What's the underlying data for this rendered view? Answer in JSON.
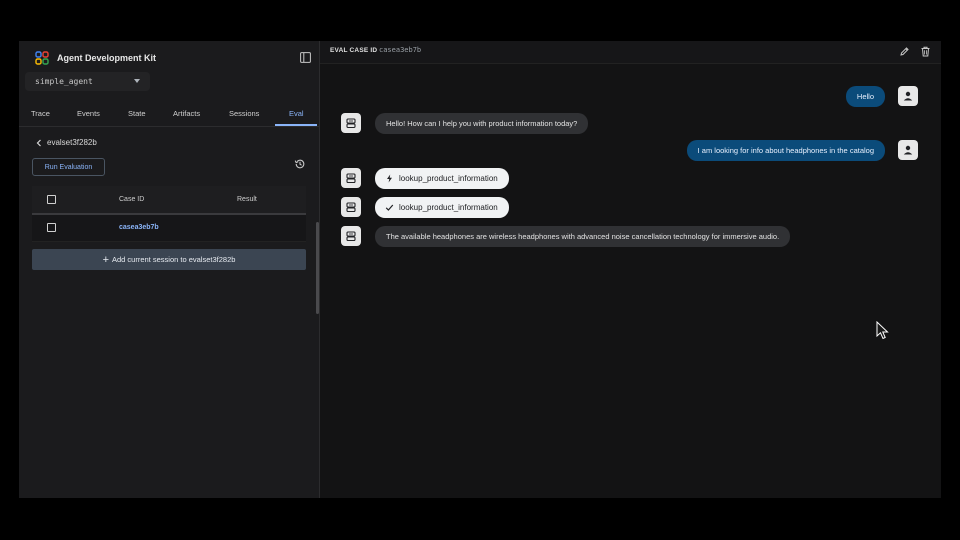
{
  "sidebar": {
    "brand_title": "Agent Development Kit",
    "agent_select_value": "simple_agent",
    "tabs": [
      "Trace",
      "Events",
      "State",
      "Artifacts",
      "Sessions",
      "Eval"
    ],
    "active_tab": "Eval",
    "breadcrumb": "evalset3f282b",
    "run_evaluation_label": "Run Evaluation",
    "table": {
      "columns": [
        "Case ID",
        "Result"
      ],
      "rows": [
        {
          "case_id": "casea3eb7b",
          "result": ""
        }
      ]
    },
    "add_session_label": "Add current session to evalset3f282b"
  },
  "main": {
    "header_label": "EVAL CASE ID",
    "header_case_id": "casea3eb7b",
    "messages": [
      {
        "role": "user",
        "text": "Hello"
      },
      {
        "role": "bot",
        "text": "Hello! How can I help you with product information today?"
      },
      {
        "role": "user",
        "text": "I am looking for info about headphones in the catalog"
      },
      {
        "role": "function_call",
        "icon": "bolt-icon",
        "text": "lookup_product_information"
      },
      {
        "role": "function_response",
        "icon": "check-icon",
        "text": "lookup_product_information"
      },
      {
        "role": "bot",
        "text": "The available headphones are wireless headphones with advanced noise cancellation technology for immersive audio."
      }
    ]
  },
  "colors": {
    "accent": "#8ab4f8",
    "user_bubble": "#0b4b7a",
    "bot_bubble": "#303134",
    "function_bubble": "#f1f3f4",
    "background": "#131314",
    "sidebar_background": "#1b1b1d"
  }
}
